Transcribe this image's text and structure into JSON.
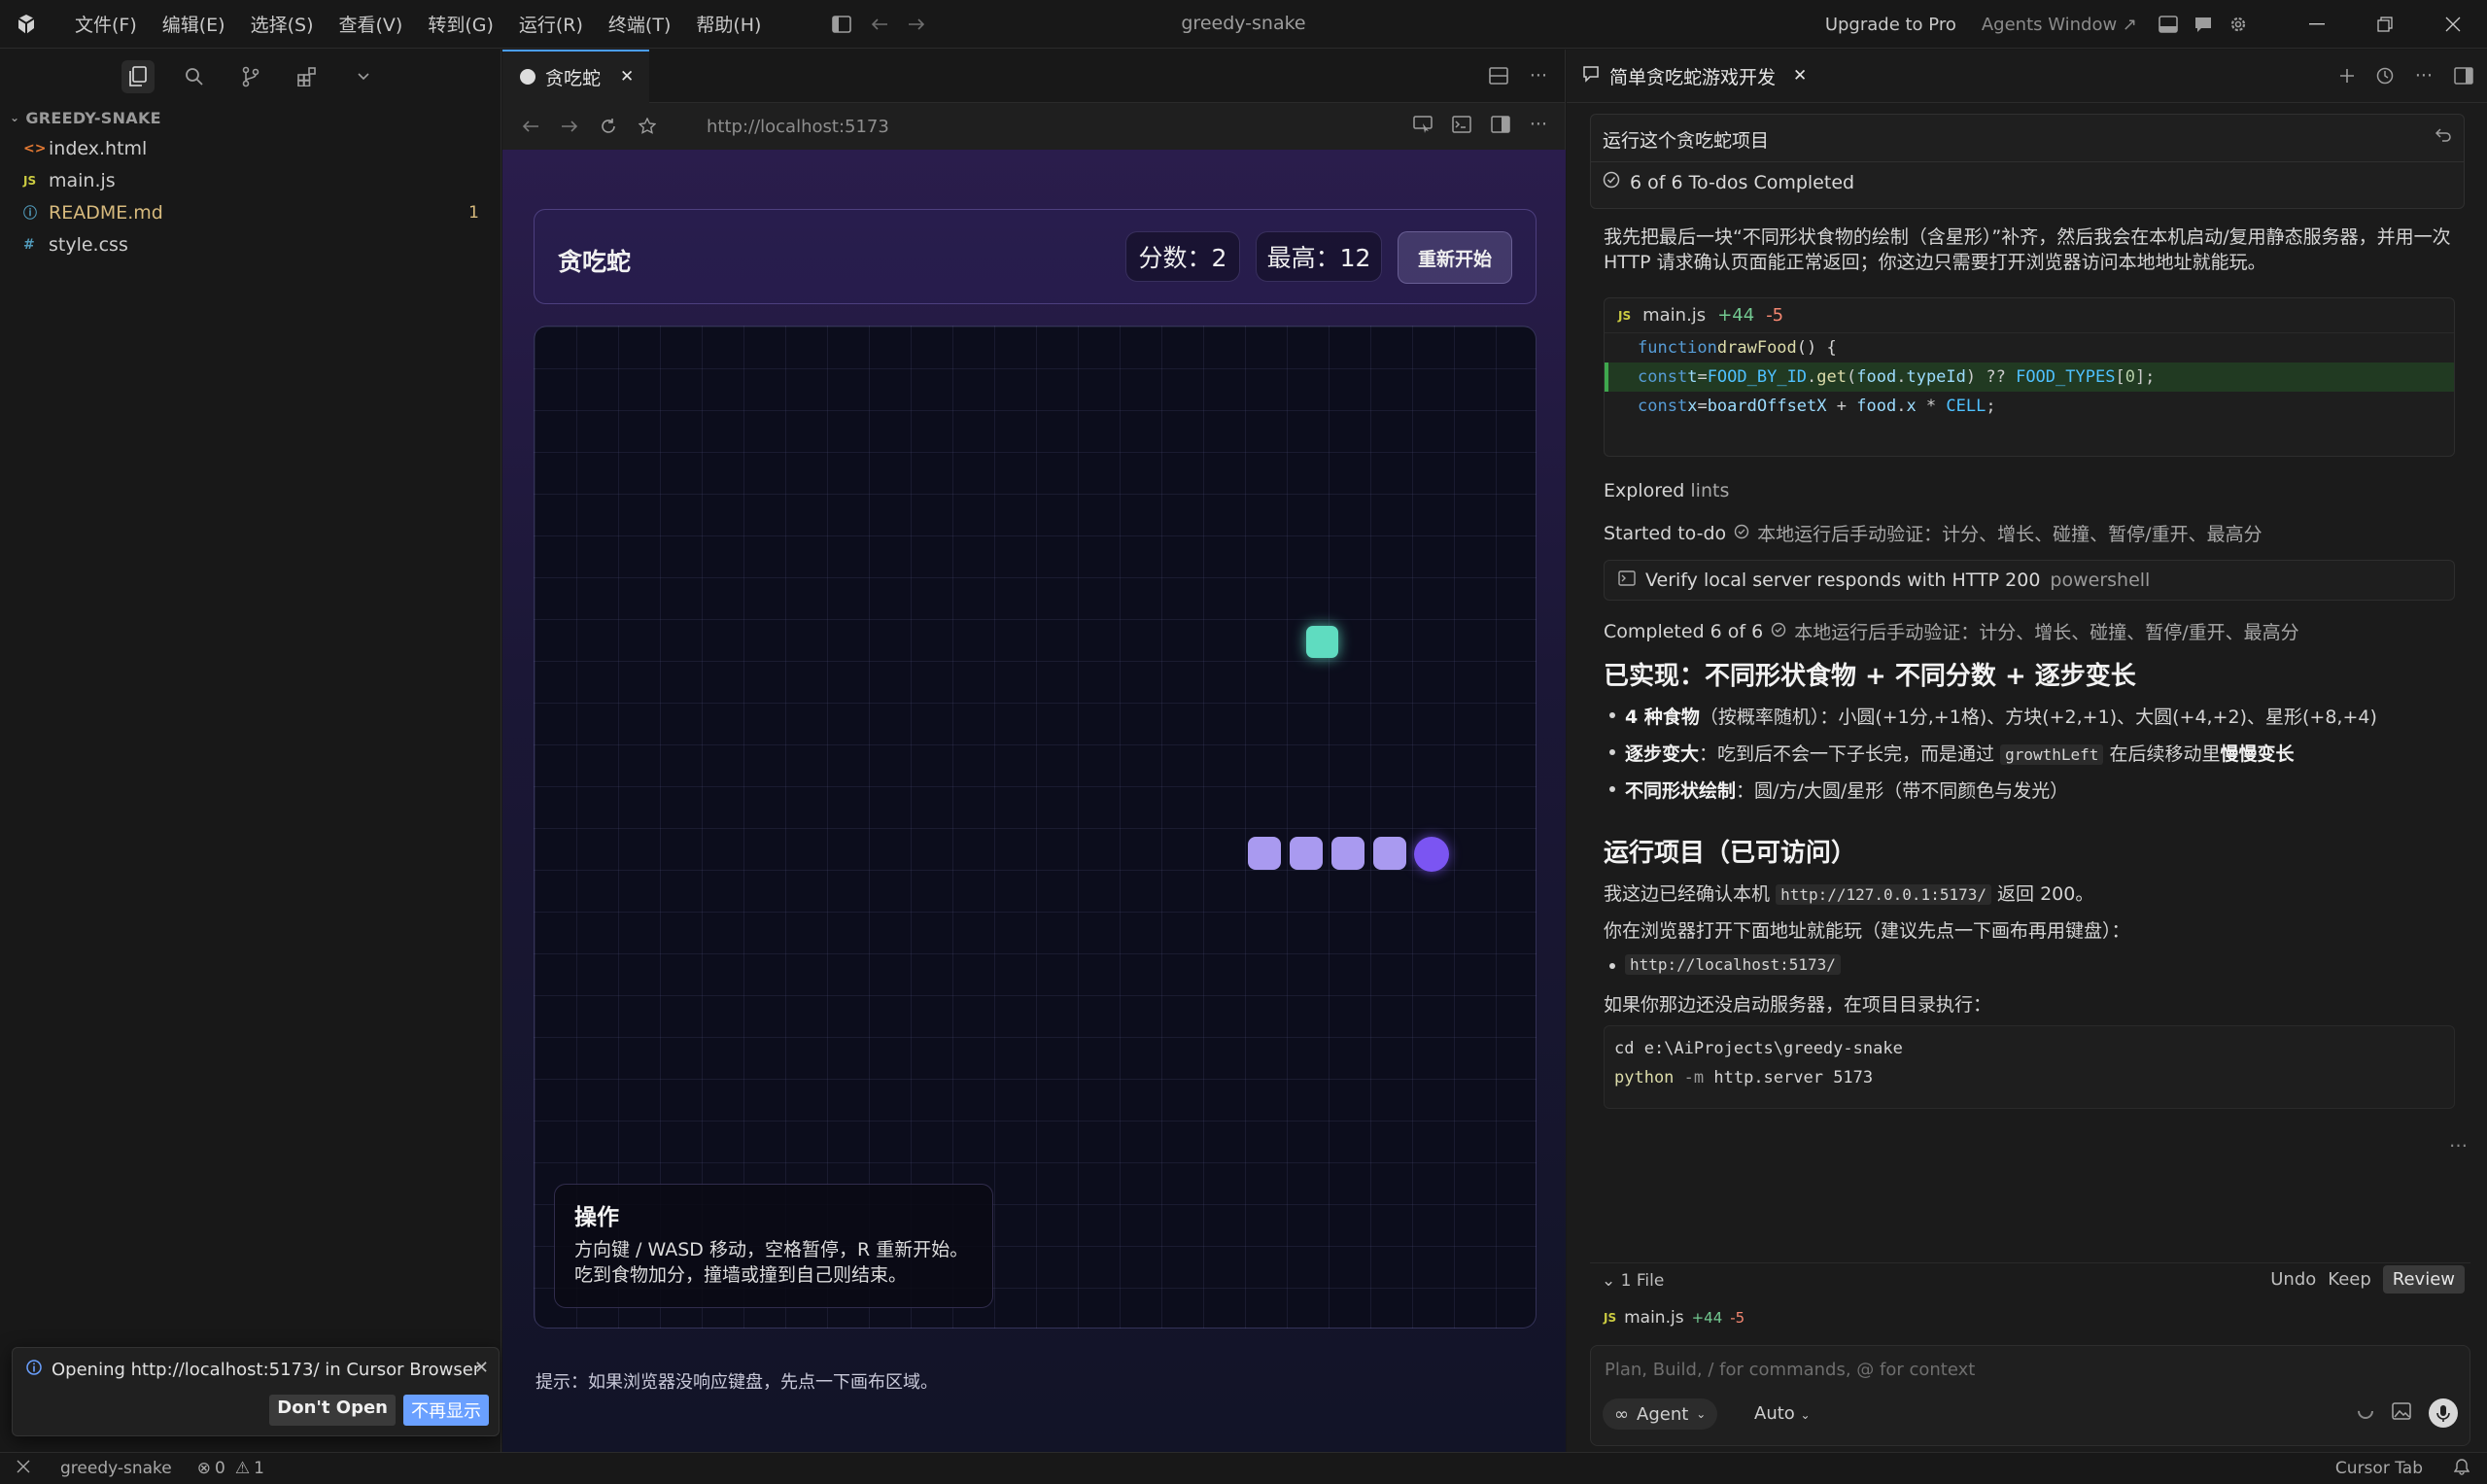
{
  "titlebar": {
    "menu": [
      "文件(F)",
      "编辑(E)",
      "选择(S)",
      "查看(V)",
      "转到(G)",
      "运行(R)",
      "终端(T)",
      "帮助(H)"
    ],
    "title": "greedy-snake",
    "upgrade": "Upgrade to Pro",
    "agents_window": "Agents Window ↗"
  },
  "explorer": {
    "header": "GREEDY-SNAKE",
    "files": [
      {
        "icon": "<>",
        "name": "index.html",
        "color": "#e37933"
      },
      {
        "icon": "JS",
        "name": "main.js",
        "color": "#cbcb41"
      },
      {
        "icon": "ⓘ",
        "name": "README.md",
        "color": "#519aba",
        "badge": "1"
      },
      {
        "icon": "#",
        "name": "style.css",
        "color": "#519aba"
      }
    ]
  },
  "notification": {
    "message": "Opening http://localhost:5173/ in Cursor Browser",
    "dont_open": "Don't Open",
    "never_show": "不再显示"
  },
  "browser": {
    "tab_label": "贪吃蛇",
    "url": "http://localhost:5173"
  },
  "game": {
    "title": "贪吃蛇",
    "score": "分数：2",
    "best": "最高：12",
    "restart": "重新开始",
    "help_title": "操作",
    "help_line1": "方向键 / WASD 移动，空格暂停，R 重新开始。",
    "help_line2": "吃到食物加分，撞墙或撞到自己则结束。",
    "hint": "提示：如果浏览器没响应键盘，先点一下画布区域。",
    "food_color": "#5fdcc0",
    "snake_body_color": "#a99af0",
    "snake_head_color": "#7b55f2"
  },
  "chat": {
    "tab_title": "简单贪吃蛇游戏开发",
    "query": "运行这个贪吃蛇项目",
    "todos": "6 of 6 To-dos Completed",
    "intro": "我先把最后一块“不同形状食物的绘制（含星形）”补齐，然后我会在本机启动/复用静态服务器，并用一次 HTTP 请求确认页面能正常返回；你这边只需要打开浏览器访问本地地址就能玩。",
    "code_file": "main.js",
    "code_add": "+44",
    "code_del": "-5",
    "explored": "Explored",
    "explored_target": "lints",
    "started": "Started to-do",
    "todo_text": "本地运行后手动验证：计分、增长、碰撞、暂停/重开、最高分",
    "term_text": "Verify local server responds with HTTP 200",
    "term_shell": "powershell",
    "completed": "Completed 6 of 6",
    "h_impl": "已实现：不同形状食物 + 不同分数 + 逐步变长",
    "b1_bold": "4 种食物",
    "b1_rest": "（按概率随机）：小圆(+1分,+1格)、方块(+2,+1)、大圆(+4,+2)、星形(+8,+4)",
    "b2_bold": "逐步变大",
    "b2_mid": "：吃到后不会一下子长完，而是通过",
    "b2_code": "growthLeft",
    "b2_after": "在后续移动里",
    "b2_bold2": "慢慢变长",
    "b3_bold": "不同形状绘制",
    "b3_rest": "：圆/方/大圆/星形（带不同颜色与发光）",
    "h_run": "运行项目（已可访问）",
    "p1_pre": "我这边已经确认本机",
    "p1_code": "http://127.0.0.1:5173/",
    "p1_post": "返回 200。",
    "p2": "你在浏览器打开下面地址就能玩（建议先点一下画布再用键盘）：",
    "p2_url": "http://localhost:5173/",
    "p3": "如果你那边还没启动服务器，在项目目录执行：",
    "cmd1": "cd e:\\AiProjects\\greedy-snake",
    "cmd2_a": "python",
    "cmd2_b": " -m ",
    "cmd2_c": "http.server 5173",
    "ellipsis": "…",
    "files_count": "1 File",
    "undo": "Undo",
    "keep": "Keep",
    "review": "Review",
    "changed_file": "main.js",
    "input_placeholder": "Plan, Build, / for commands, @ for context",
    "agent": "Agent",
    "auto": "Auto"
  },
  "statusbar": {
    "project": "greedy-snake",
    "errors": "0",
    "warnings": "1",
    "cursor_tab": "Cursor Tab"
  }
}
